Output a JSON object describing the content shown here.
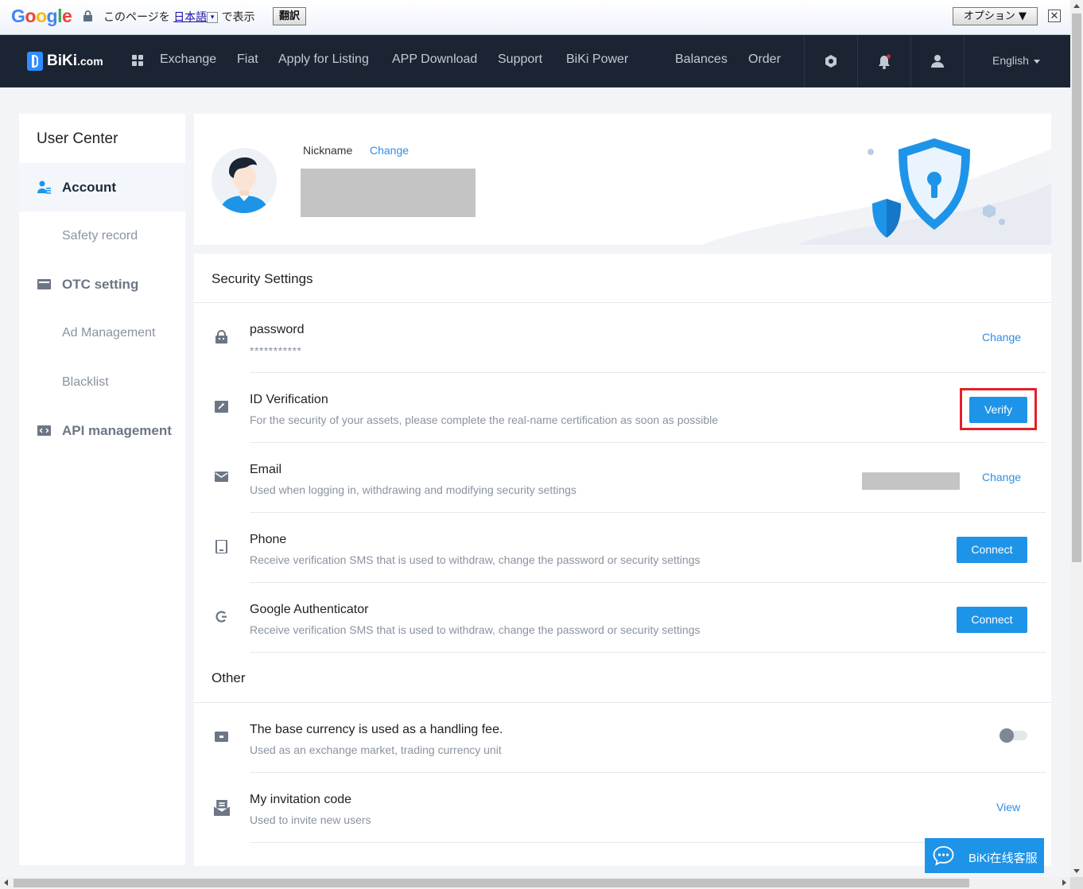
{
  "translate_bar": {
    "logo": "Google",
    "message_prefix": "このページを",
    "language": "日本語",
    "dropdown": "▾",
    "message_suffix": "で表示",
    "translate_button": "翻訳",
    "options_button": "オプション ▼",
    "close": "✕"
  },
  "nav": {
    "logo": "BiKi",
    "logo_suffix": ".com",
    "items": [
      "Exchange",
      "Fiat",
      "Apply for Listing",
      "APP Download",
      "Support",
      "BiKi Power"
    ],
    "right_items": [
      "Balances",
      "Order"
    ],
    "language": "English"
  },
  "sidebar": {
    "title": "User Center",
    "items": [
      {
        "label": "Account",
        "icon": "user-card-icon",
        "active": true
      },
      {
        "label": "Safety record"
      },
      {
        "label": "OTC setting",
        "icon": "card-icon"
      },
      {
        "label": "Ad Management"
      },
      {
        "label": "Blacklist"
      },
      {
        "label": "API management",
        "icon": "code-icon"
      }
    ]
  },
  "profile": {
    "nickname_label": "Nickname",
    "change_label": "Change"
  },
  "security": {
    "title": "Security Settings",
    "rows": [
      {
        "title": "password",
        "subtitle": "***********",
        "action": "Change",
        "icon": "lock-icon"
      },
      {
        "title": "ID Verification",
        "subtitle": "For the security of your assets, please complete the real-name certification as soon as possible",
        "action": "Verify",
        "icon": "id-card-icon"
      },
      {
        "title": "Email",
        "subtitle": "Used when logging in, withdrawing and modifying security settings",
        "action": "Change",
        "icon": "mail-icon"
      },
      {
        "title": "Phone",
        "subtitle": "Receive verification SMS that is used to withdraw, change the password or security settings",
        "action": "Connect",
        "icon": "phone-icon"
      },
      {
        "title": "Google Authenticator",
        "subtitle": "Receive verification SMS that is used to withdraw, change the password or security settings",
        "action": "Connect",
        "icon": "google-auth-icon"
      }
    ]
  },
  "other": {
    "title": "Other",
    "rows": [
      {
        "title": "The base currency is used as a handling fee.",
        "subtitle": "Used as an exchange market, trading currency unit",
        "icon": "coin-icon",
        "toggle_on": false
      },
      {
        "title": "My invitation code",
        "subtitle": "Used to invite new users",
        "action": "View",
        "icon": "invite-icon"
      }
    ]
  },
  "chat": {
    "label": "BiKi在线客服"
  },
  "colors": {
    "nav_bg": "#1b2433",
    "accent": "#1e94e8",
    "link": "#2d8de6",
    "highlight": "#e3202c"
  }
}
